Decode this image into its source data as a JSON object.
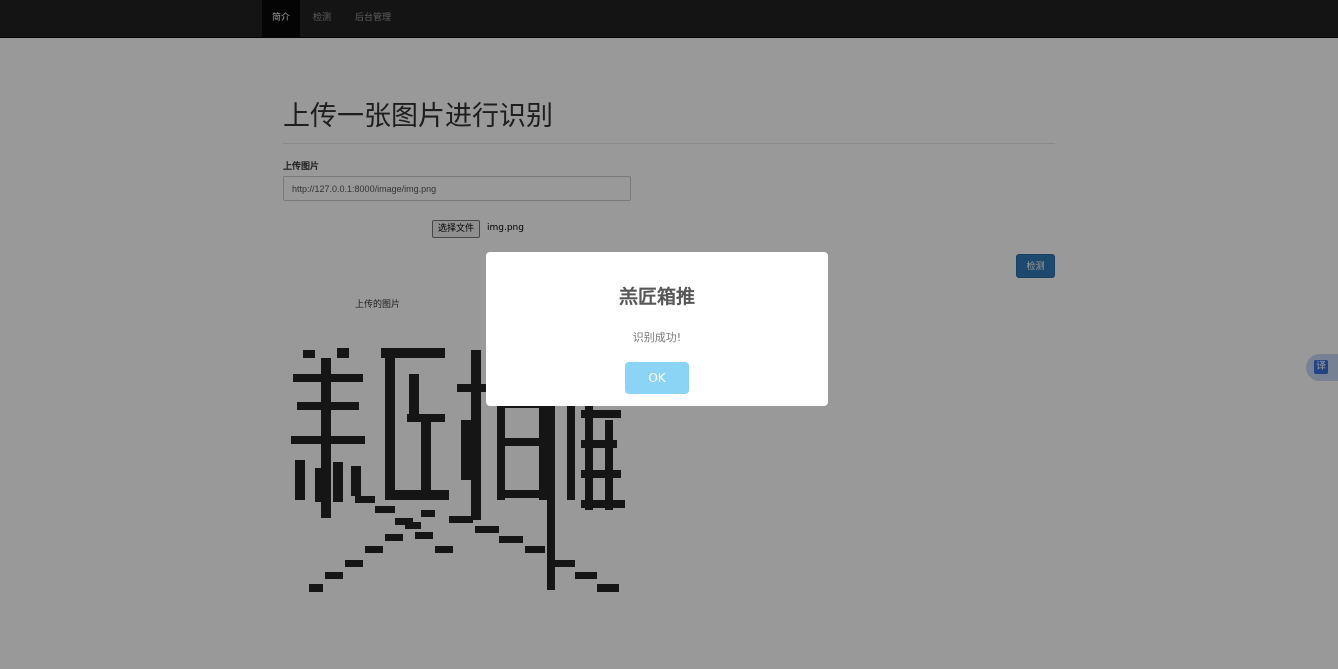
{
  "nav": {
    "items": [
      {
        "label": "简介",
        "active": true
      },
      {
        "label": "检测",
        "active": false
      },
      {
        "label": "后台管理",
        "active": false
      }
    ]
  },
  "page": {
    "title": "上传一张图片进行识别",
    "field_label": "上传图片",
    "url_value": "http://127.0.0.1:8000/image/img.png",
    "file_button": "选择文件",
    "file_name": "img.png",
    "detect_button": "检测",
    "uploaded_caption": "上传的图片"
  },
  "captcha_image": {
    "characters": "羔匠相推"
  },
  "translate_widget": {
    "glyph": "译"
  },
  "dialog": {
    "title": "羔匠箱推",
    "text": "识别成功!",
    "ok_label": "OK"
  },
  "colors": {
    "navbar": "#222222",
    "primary": "#337ab7",
    "ok_button": "#8cd4f5",
    "overlay": "rgba(0,0,0,0.4)"
  }
}
